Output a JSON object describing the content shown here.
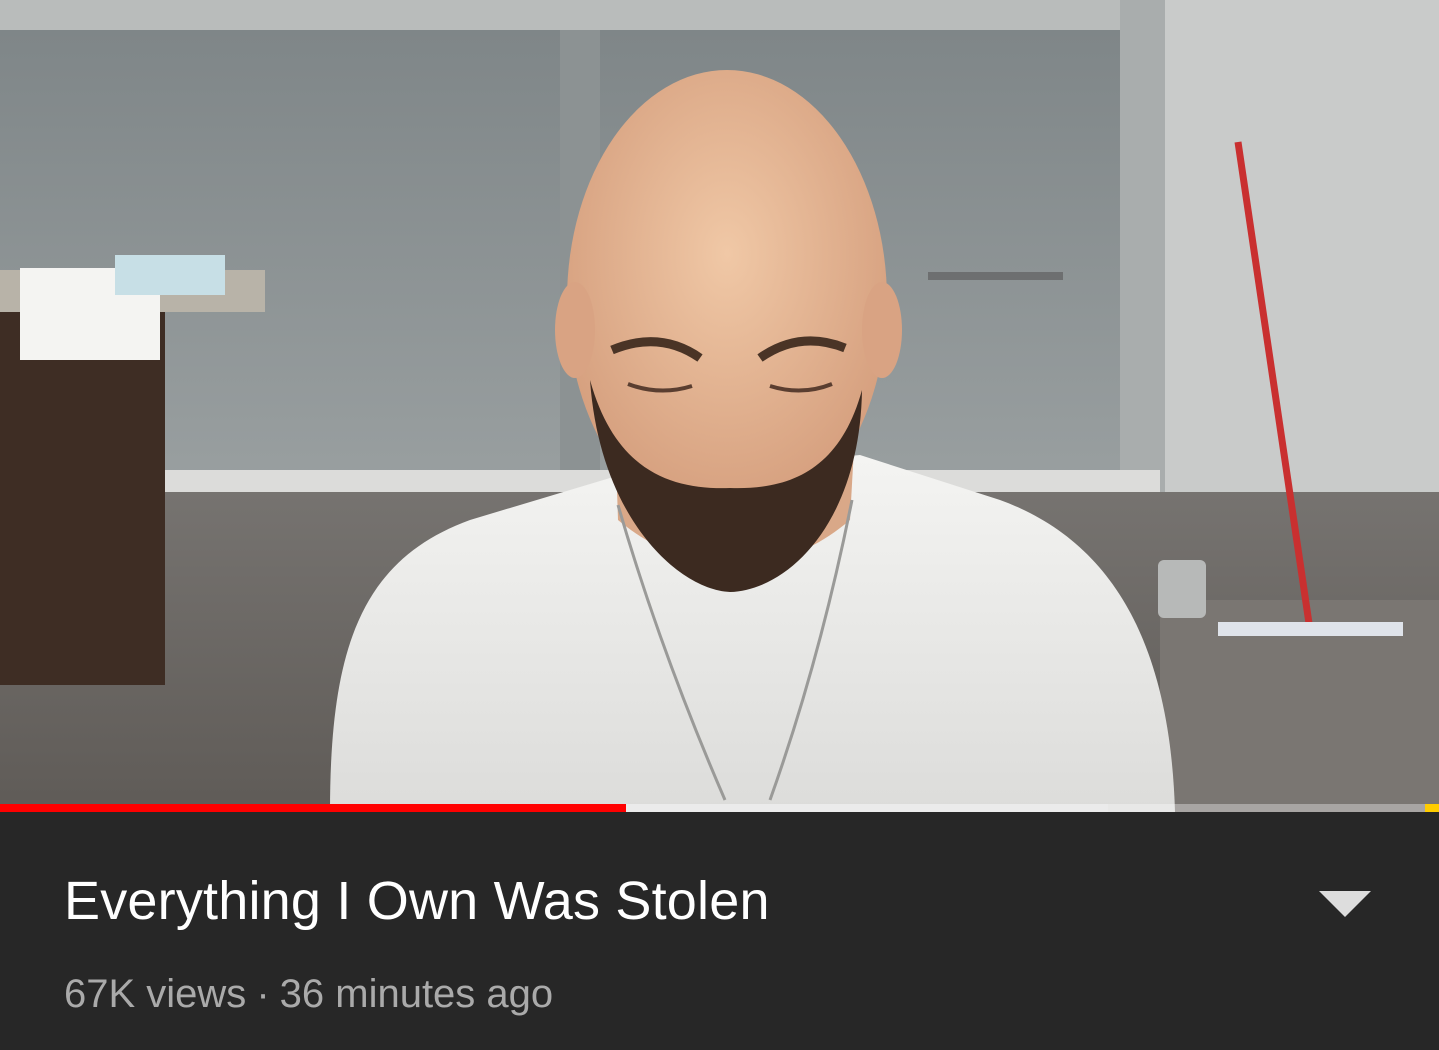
{
  "video": {
    "progress": {
      "played_fraction": 0.435,
      "buffered_fraction": 0.77,
      "played_color": "#ff0000",
      "ad_marker_color": "#ffcc00"
    }
  },
  "details": {
    "title": "Everything I Own Was Stolen",
    "views": "67K views",
    "separator": "·",
    "published": "36 minutes ago",
    "expand_icon": "chevron-down-icon"
  }
}
